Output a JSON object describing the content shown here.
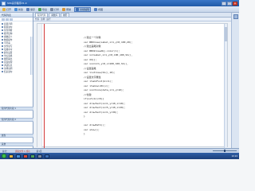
{
  "window": {
    "title": "SSS演示程序V1.0"
  },
  "toolbar": {
    "items": [
      {
        "icon": "folder-icon",
        "label": "打开",
        "color": "#e3b443"
      },
      {
        "icon": "new-icon",
        "label": "新建",
        "color": "#4a8fd8"
      },
      {
        "icon": "save-icon",
        "label": "保存",
        "color": "#5b7fb9"
      },
      {
        "icon": "export-icon",
        "label": "导出",
        "color": "#4fa35a"
      },
      {
        "icon": "print-icon",
        "label": "打印",
        "color": "#7b8aa0"
      },
      {
        "icon": "help-icon",
        "label": "帮助",
        "color": "#d6973b"
      },
      {
        "icon": "document-icon",
        "label": "文档编辑",
        "color": "#3c6fb5",
        "active": true
      },
      {
        "icon": "grid-icon",
        "label": "视图",
        "color": "#4f7cc0"
      }
    ]
  },
  "left_pane": {
    "header": "代码列表",
    "items": [
      "变量声明",
      "赋值语句",
      "条件判断",
      "循环结构",
      "函数定义",
      "数组操作",
      "字符串",
      "文件读写",
      "绘图命令",
      "颜色设置",
      "坐标变换",
      "图形输出",
      "错误处理",
      "调试信息",
      "注释说明",
      "结束语句"
    ],
    "bar1": "程序代码片段 1",
    "bar2": "程序代码片段 2",
    "bar3": "属性",
    "bar4": "其他"
  },
  "editor": {
    "tabs": [
      "程序代码",
      "函数库",
      "图形"
    ],
    "active_tab": "程序代码",
    "subtabs": [
      "代码",
      "注释",
      "运行"
    ],
    "code_lines": [
      "//建立一个对象",
      "var BBX=new(Label,x=1,y=0,100,20);",
      "//建立画笔对象",
      "var BBX2=newObj.color(1);",
      "var xx=Label,x=1,y=0,100,100,SS(),",
      "var XX[];",
      "var xxx=x=1,y=0,x=100,100,SS(),",
      "//设置画笔",
      "var list=new(SS(),10);",
      "//设置文字属性",
      "var item=Font(bi=1);",
      "var item=width(c);",
      "var xxx=Size(data,x=1,y=10);",
      "//创建",
      "if(not(bi)=0){",
      "var drawText(xx=1,y=10,x=10);",
      "var drawText(xx=5,y=10,x=20);",
      "var drawText(xx=1,y=30);",
      "}",
      "",
      "var drawPath();",
      "var show();",
      "}"
    ]
  },
  "status": {
    "left": "总计：",
    "middle": "读取文件 1 成功",
    "right": "第1页"
  },
  "taskbar": {
    "time": "10:24",
    "icons": [
      "#e3b443",
      "#4a8fd8",
      "#d84a3a",
      "#4fa35a",
      "#7b8aa0",
      "#3c6fb5"
    ]
  }
}
